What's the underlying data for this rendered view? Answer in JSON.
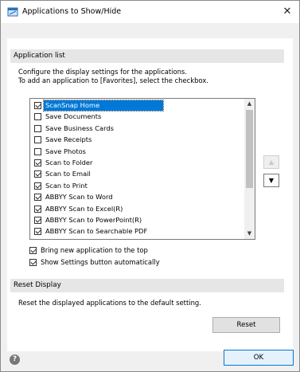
{
  "window": {
    "title": "Applications to Show/Hide",
    "close_glyph": "✕",
    "icon": "app-window-icon"
  },
  "application_list": {
    "header": "Application list",
    "description_line1": "Configure the display settings for the applications.",
    "description_line2": "To add an application to [Favorites], select the checkbox.",
    "items": [
      {
        "label": "ScanSnap Home",
        "checked": true,
        "selected": true
      },
      {
        "label": "Save Documents",
        "checked": false,
        "selected": false
      },
      {
        "label": "Save Business Cards",
        "checked": false,
        "selected": false
      },
      {
        "label": "Save Receipts",
        "checked": false,
        "selected": false
      },
      {
        "label": "Save Photos",
        "checked": false,
        "selected": false
      },
      {
        "label": "Scan to Folder",
        "checked": true,
        "selected": false
      },
      {
        "label": "Scan to Email",
        "checked": true,
        "selected": false
      },
      {
        "label": "Scan to Print",
        "checked": true,
        "selected": false
      },
      {
        "label": "ABBYY Scan to Word",
        "checked": true,
        "selected": false
      },
      {
        "label": "ABBYY Scan to Excel(R)",
        "checked": true,
        "selected": false
      },
      {
        "label": "ABBYY Scan to PowerPoint(R)",
        "checked": true,
        "selected": false
      },
      {
        "label": "ABBYY Scan to Searchable PDF",
        "checked": true,
        "selected": false
      }
    ],
    "move_up_glyph": "▲",
    "move_down_glyph": "▼",
    "scroll_up_glyph": "▲",
    "scroll_down_glyph": "▼",
    "options": [
      {
        "label": "Bring new application to the top",
        "checked": true
      },
      {
        "label": "Show Settings button automatically",
        "checked": true
      }
    ]
  },
  "reset_display": {
    "header": "Reset Display",
    "description": "Reset the displayed applications to the default setting.",
    "button_label": "Reset"
  },
  "footer": {
    "help_glyph": "?",
    "ok_label": "OK"
  }
}
